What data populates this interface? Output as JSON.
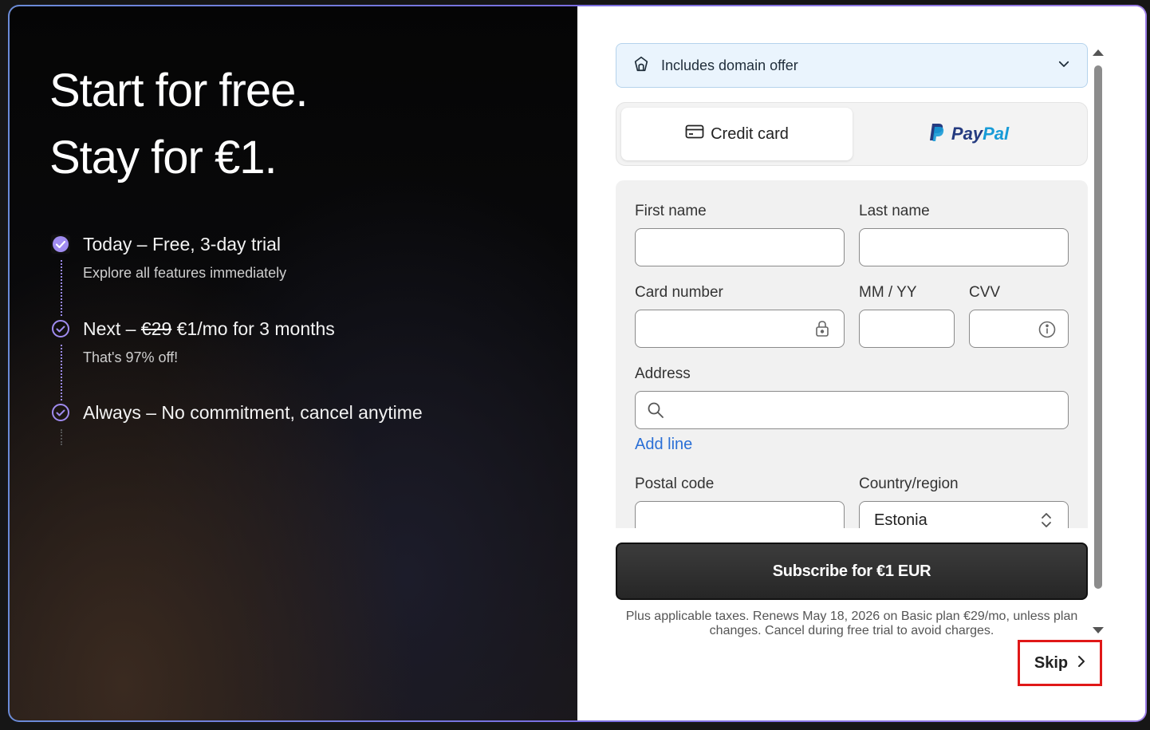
{
  "hero": {
    "line1": "Start for free.",
    "line2": "Stay for €1."
  },
  "steps": [
    {
      "prefix": "Today – Free, 3-day trial",
      "sub": "Explore all features immediately"
    },
    {
      "prefix": "Next – ",
      "old_price": "€29",
      "rest": " €1/mo for 3 months",
      "sub": "That's 97% off!"
    },
    {
      "prefix": "Always – No commitment, cancel anytime"
    }
  ],
  "domain_offer": {
    "label": "Includes domain offer"
  },
  "payment_tabs": {
    "credit_card": "Credit card",
    "paypal_pay": "Pay",
    "paypal_pal": "Pal"
  },
  "form": {
    "first_name_label": "First name",
    "last_name_label": "Last name",
    "card_number_label": "Card number",
    "expiry_label": "MM / YY",
    "cvv_label": "CVV",
    "address_label": "Address",
    "add_line": "Add line",
    "postal_code_label": "Postal code",
    "country_label": "Country/region",
    "country_value": "Estonia"
  },
  "subscribe_label": "Subscribe for €1 EUR",
  "terms": "Plus applicable taxes. Renews May 18, 2026 on Basic plan €29/mo, unless plan changes. Cancel during free trial to avoid charges.",
  "skip_label": "Skip",
  "colors": {
    "accent_purple": "#a08cf0",
    "link_blue": "#2a6fd6",
    "highlight_red": "#e01818"
  }
}
